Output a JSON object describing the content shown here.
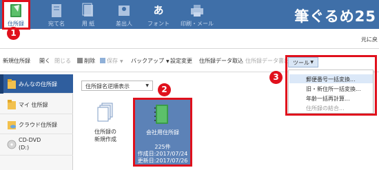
{
  "ribbon": {
    "tabs": [
      {
        "label": "住所録",
        "icon": "address-book-icon",
        "active": true
      },
      {
        "label": "宛て名",
        "icon": "address-label-icon",
        "active": false
      },
      {
        "label": "用 紙",
        "icon": "paper-icon",
        "active": false
      },
      {
        "label": "差出人",
        "icon": "sender-icon",
        "active": false
      },
      {
        "label": "フォント",
        "icon": "font-icon",
        "active": false,
        "icon_text": "あ"
      },
      {
        "label": "印刷・メール",
        "icon": "printer-icon",
        "active": false
      }
    ],
    "brand": "筆ぐるめ25"
  },
  "corner_text": "元に戻",
  "toolbar": {
    "new_label": "新規住所録",
    "open_label": "開く",
    "close_label": "閉じる",
    "delete_label": "削除",
    "save_label": "保存",
    "backup_label": "バックアップ",
    "settings_label": "設定変更",
    "import_label": "住所録データ取込",
    "export_label": "住所録データ書出",
    "tools_label": "ツール"
  },
  "sidebar": {
    "items": [
      {
        "label": "みんなの住所録",
        "icon": "folder-icon",
        "selected": true
      },
      {
        "label": "マイ 住所録",
        "icon": "folder-icon",
        "selected": false
      },
      {
        "label": "クラウド住所録",
        "icon": "cloud-folder-icon",
        "selected": false
      },
      {
        "label": "CD-DVD",
        "label2": "(D:)",
        "icon": "disc-icon",
        "selected": false
      }
    ]
  },
  "main": {
    "sort_select": "住所録名逆順表示",
    "new_card": {
      "line1": "住所録の",
      "line2": "新規作成"
    },
    "address_book": {
      "name": "会社用住所録",
      "count": "225件",
      "created": "作成日:2017/07/24",
      "updated": "更新日:2017/07/26"
    }
  },
  "tools_menu": {
    "items": [
      {
        "label": "郵便番号一括変換...",
        "highlighted": true,
        "disabled": false
      },
      {
        "label": "旧・新住所一括変換...",
        "highlighted": false,
        "disabled": false
      },
      {
        "label": "年齢一括再計算...",
        "highlighted": false,
        "disabled": false
      },
      {
        "label": "住所録の結合...",
        "highlighted": false,
        "disabled": true
      }
    ]
  },
  "callouts": [
    "1",
    "2",
    "3"
  ],
  "colors": {
    "ribbon": "#3f6fa8",
    "accent_red": "#e0101c",
    "selection": "#2f5e9e",
    "card": "#5c82b7"
  }
}
